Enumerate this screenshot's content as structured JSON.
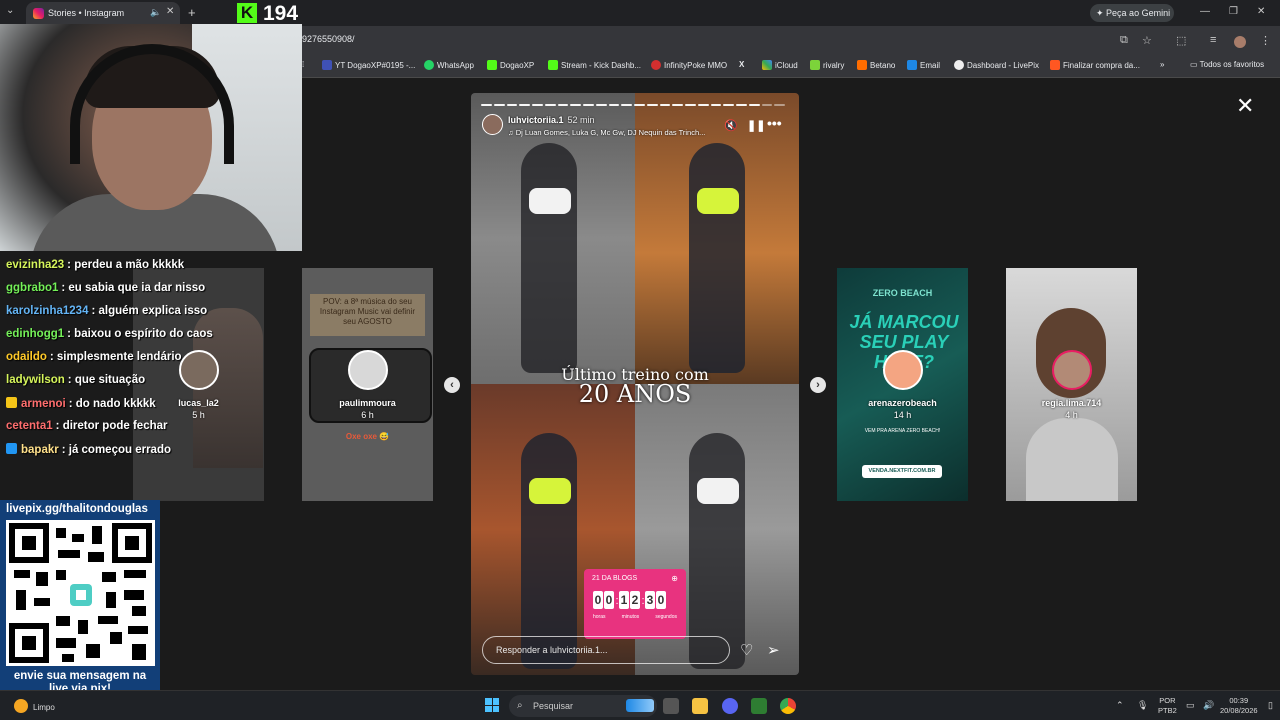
{
  "browser": {
    "tab_title": "Stories • Instagram",
    "url": "9276550908/",
    "gemini_label": "Peça ao Gemini",
    "bookmarks": [
      "YT DogaoXP#0195 -...",
      "WhatsApp",
      "DogaoXP",
      "Stream - Kick Dashb...",
      "InfinityPoke MMO",
      "iCloud",
      "rivalry",
      "Betano",
      "Email",
      "Dashboard - LivePix",
      "Finalizar compra da..."
    ],
    "all_bookmarks": "Todos os favoritos"
  },
  "stream": {
    "viewers": "194"
  },
  "chat": [
    {
      "user": "evizinha23",
      "text": ": perdeu a mão kkkkk",
      "color": "#d6f55b"
    },
    {
      "user": "ggbrabo1",
      "text": ": eu sabia que ia dar nisso",
      "color": "#74f058"
    },
    {
      "user": "karolzinha1234",
      "text": ": alguém explica isso",
      "color": "#64b5f6"
    },
    {
      "user": "edinhogg1",
      "text": ": baixou o espírito do caos",
      "color": "#74f058"
    },
    {
      "user": "odaildo",
      "text": ": simplesmente lendário",
      "color": "#ffca28"
    },
    {
      "user": "ladywilson",
      "text": ": que situação",
      "color": "#d6f55b"
    },
    {
      "user": "armenoi",
      "text": ": do nado kkkkk",
      "color": "#ff6e6e"
    },
    {
      "user": "cetenta1",
      "text": ": diretor pode fechar",
      "color": "#ff6e6e"
    },
    {
      "user": "bapakr",
      "text": ": já começou errado",
      "color": "#ffe08a"
    }
  ],
  "livepix": {
    "url": "livepix.gg/thalitondouglas",
    "caption_line1": "envie sua mensagem na",
    "caption_line2": "live via pix!"
  },
  "cards": [
    {
      "name": "lucas_la2",
      "time": "5 h"
    },
    {
      "name": "paulimmoura",
      "time": "6 h",
      "text_top": "POV: a 8ª música do seu Instagram Music vai definir seu AGOSTO",
      "text_bottom": "Oxe oxe 😅"
    },
    {
      "name": "arenazerobeach",
      "time": "14 h",
      "brand": "ZERO BEACH",
      "big_text": "JÁ MARCOU SEU PLAY HOJE?",
      "sub": "VEM PRA ARENA ZERO BEACH!",
      "link": "VENDA.NEXTFIT.COM.BR"
    },
    {
      "name": "regia.lima.714",
      "time": "4 h"
    }
  ],
  "story": {
    "username": "luhvictoriia.1",
    "time": "52 min",
    "music": "Dj Luan Gomes, Luka G, Mc Gw, DJ Nequin das Trinch...",
    "headline1": "Último treino com",
    "headline2": "20 ANOS",
    "countdown_title": "21 DA BLOGS",
    "countdown_digits": [
      "0",
      "0",
      "1",
      "2",
      "3",
      "0"
    ],
    "countdown_labels": [
      "horas",
      "minutos",
      "segundos"
    ],
    "reply_placeholder": "Responder a luhvictoriia.1..."
  },
  "taskbar": {
    "weather": "Limpo",
    "search_placeholder": "Pesquisar",
    "lang1": "POR",
    "lang2": "PTB2",
    "clock": "00:39",
    "date": "20/08/2026"
  }
}
